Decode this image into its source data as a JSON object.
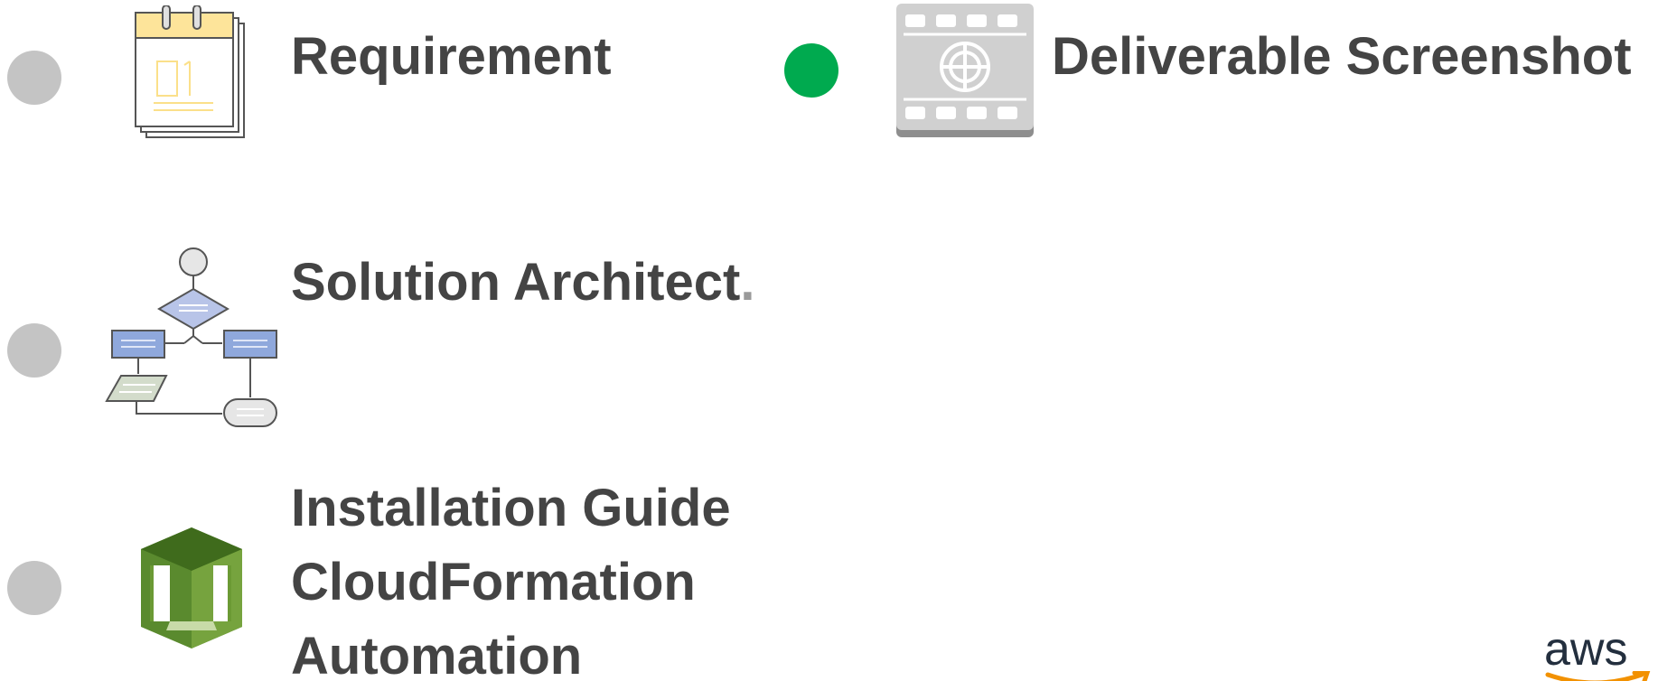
{
  "items": [
    {
      "label": "Requirement",
      "status": "pending",
      "icon": "calendar-icon"
    },
    {
      "label": "Solution Architect",
      "suffix": ".",
      "status": "pending",
      "icon": "flowchart-icon"
    },
    {
      "label_lines": [
        "Installation Guide",
        "CloudFormation",
        "Automation"
      ],
      "status": "pending",
      "icon": "cloudformation-icon"
    },
    {
      "label": "Deliverable Screenshot",
      "status": "done",
      "icon": "film-strip-icon"
    }
  ],
  "colors": {
    "pending_dot": "#c4c4c4",
    "done_dot": "#00aa4f",
    "text": "#444444"
  },
  "logo": {
    "text": "aws",
    "icon": "aws-logo-icon"
  }
}
